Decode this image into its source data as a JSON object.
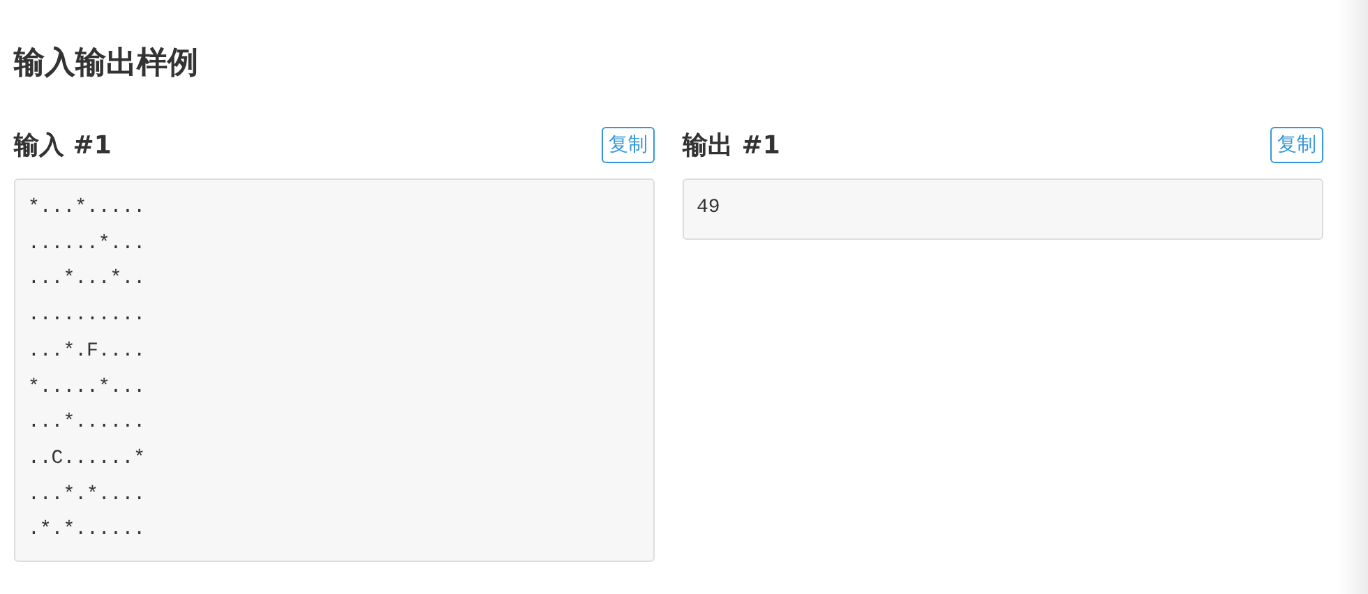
{
  "title": "输入输出样例",
  "samples": [
    {
      "heading": "输入 #1",
      "copy_button": "复制",
      "lines": [
        "*...*.....",
        "......*...",
        "...*...*..",
        "..........",
        "...*.F....",
        "*.....*...",
        "...*......",
        "..C......*",
        "...*.*....",
        ".*.*......"
      ]
    },
    {
      "heading": "输出 #1",
      "copy_button": "复制",
      "lines": [
        "49"
      ]
    }
  ]
}
